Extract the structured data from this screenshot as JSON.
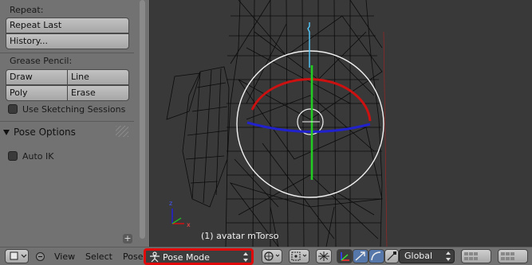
{
  "toolshelf": {
    "repeat": {
      "label": "Repeat:",
      "repeat_last": "Repeat Last",
      "history": "History..."
    },
    "grease_pencil": {
      "label": "Grease Pencil:",
      "draw": "Draw",
      "line": "Line",
      "poly": "Poly",
      "erase": "Erase",
      "use_sketching": "Use Sketching Sessions"
    },
    "pose_options": {
      "title": "Pose Options",
      "auto_ik": "Auto IK"
    }
  },
  "viewport": {
    "object_label": "(1) avatar mTorso"
  },
  "header": {
    "menus": {
      "view": "View",
      "select": "Select",
      "pose": "Pose"
    },
    "mode": "Pose Mode",
    "orientation": "Global"
  },
  "colors": {
    "highlight": "#e00a0a",
    "rot_x": "#cc1111",
    "rot_y": "#22cc22",
    "rot_z": "#2222cc"
  }
}
